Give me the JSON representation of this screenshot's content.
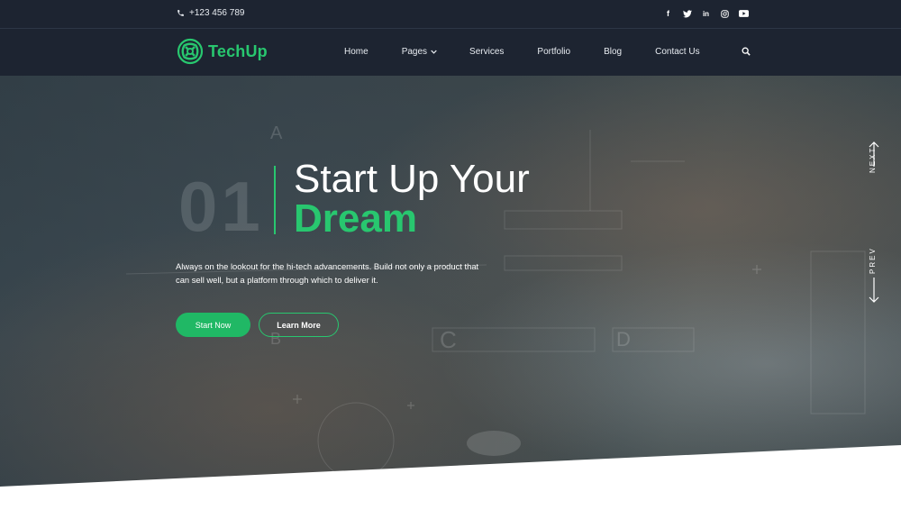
{
  "topbar": {
    "phone": "+123 456 789",
    "socials": [
      {
        "icon": "facebook-icon",
        "glyph": "f"
      },
      {
        "icon": "twitter-icon",
        "glyph": "t"
      },
      {
        "icon": "linkedin-icon",
        "glyph": "in"
      },
      {
        "icon": "instagram-icon",
        "glyph": "◎"
      },
      {
        "icon": "youtube-icon",
        "glyph": "▶"
      }
    ]
  },
  "navbar": {
    "brand": "TechUp",
    "menu": [
      "Home",
      "Pages",
      "Services",
      "Portfolio",
      "Blog",
      "Contact Us"
    ]
  },
  "hero": {
    "slide_number": "01",
    "title_line1": "Start Up Your",
    "title_line2": "Dream",
    "description": "Always on the lookout for the hi-tech advancements. Build not only a product that can sell well, but a platform through which to deliver it.",
    "primary_button": "Start Now",
    "secondary_button": "Learn More",
    "next_label": "NEXT",
    "prev_label": "PREV"
  },
  "colors": {
    "accent": "#28c76f",
    "header_bg": "#1d2431",
    "text_light": "#ffffff"
  }
}
